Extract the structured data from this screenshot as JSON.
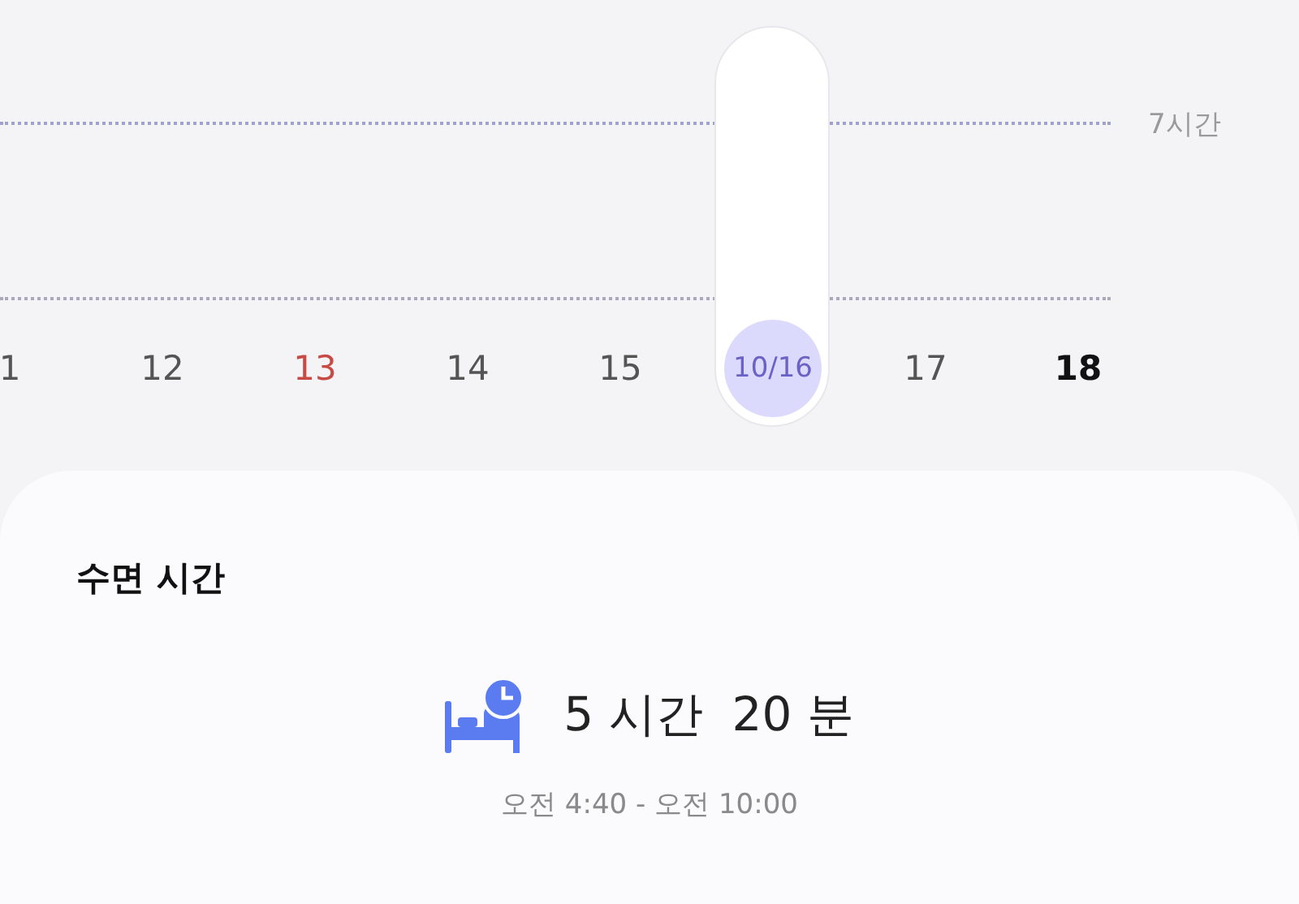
{
  "chart": {
    "goal_label": "7시간",
    "days": [
      {
        "label": "1",
        "kind": "weekday",
        "selected": false
      },
      {
        "label": "12",
        "kind": "weekday",
        "selected": false
      },
      {
        "label": "13",
        "kind": "sunday",
        "selected": false
      },
      {
        "label": "14",
        "kind": "weekday",
        "selected": false
      },
      {
        "label": "15",
        "kind": "weekday",
        "selected": false
      },
      {
        "label": "10/16",
        "kind": "weekday",
        "selected": true
      },
      {
        "label": "17",
        "kind": "weekday",
        "selected": false
      },
      {
        "label": "18",
        "kind": "today",
        "selected": false
      }
    ]
  },
  "card": {
    "title": "수면 시간",
    "duration_hours": "5 시간",
    "duration_minutes": "20 분",
    "time_range": "오전 4:40 - 오전 10:00"
  }
}
